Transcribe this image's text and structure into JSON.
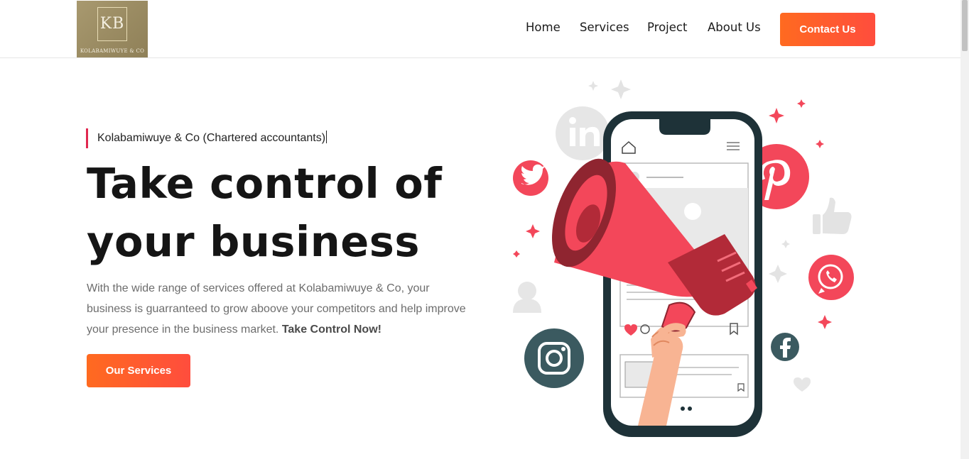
{
  "logo": {
    "monogram": "KB",
    "wordmark": "Kolabamiwuye & Co"
  },
  "nav": {
    "items": [
      {
        "label": "Home"
      },
      {
        "label": "Services"
      },
      {
        "label": "Project"
      },
      {
        "label": "About Us"
      }
    ],
    "cta": "Contact Us"
  },
  "hero": {
    "tagline": "Kolabamiwuye & Co (Chartered accountants)",
    "title_line1": "Take control of",
    "title_line2": "your business",
    "description": "With the wide range of services offered at Kolabamiwuye & Co, your business is guarranteed to grow aboove your competitors and help improve your presence in the business market.",
    "description_emphasis": "Take Control Now!",
    "button": "Our Services"
  },
  "illustration": {
    "icons": [
      "linkedin-icon",
      "twitter-icon",
      "pinterest-icon",
      "thumbs-up-icon",
      "whatsapp-icon",
      "instagram-icon",
      "facebook-icon",
      "user-icon",
      "heart-icon",
      "megaphone-icon",
      "phone-icon"
    ],
    "colors": {
      "accent": "#f3475a",
      "dark": "#22353c",
      "orange": "#ff5a2a"
    }
  }
}
